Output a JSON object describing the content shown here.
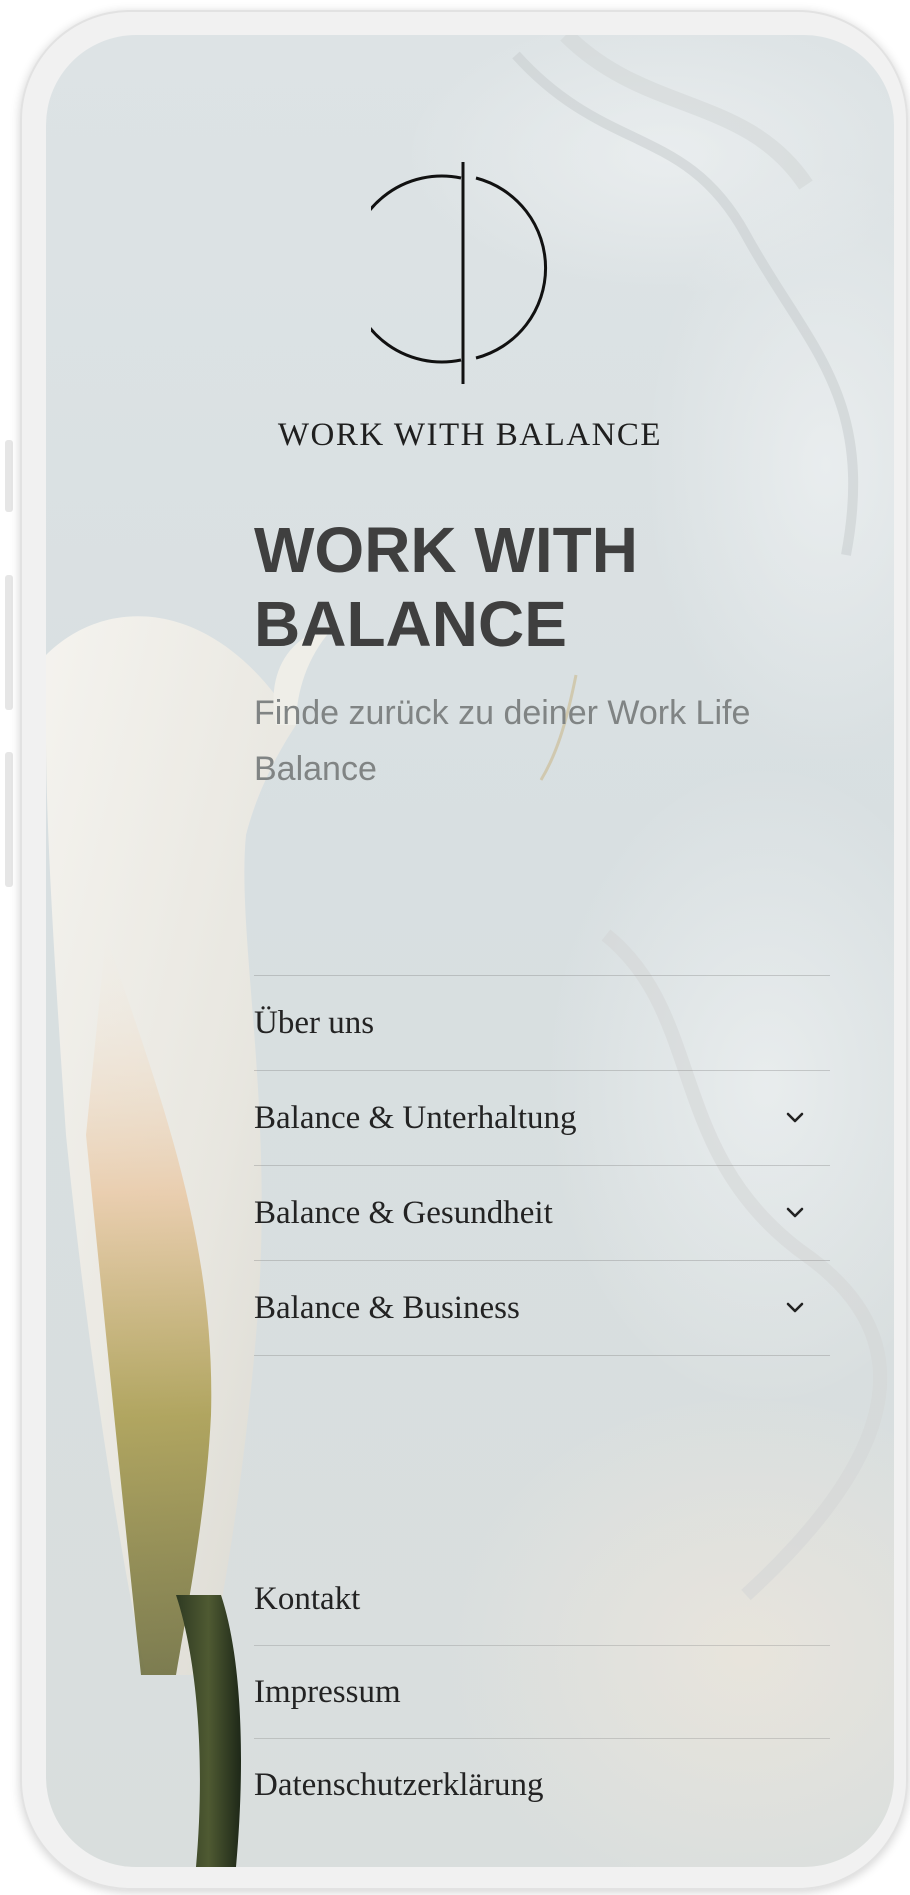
{
  "brand": {
    "logo_icon": "circle-split-logo-icon",
    "wordmark": "WORK WITH BALANCE"
  },
  "hero": {
    "title": "WORK WITH BALANCE",
    "subtitle": "Finde zurück zu deiner Work Life Balance"
  },
  "nav": {
    "items": [
      {
        "label": "Über uns",
        "has_submenu": false
      },
      {
        "label": "Balance & Unterhaltung",
        "has_submenu": true,
        "icon": "chevron-down-icon"
      },
      {
        "label": "Balance & Gesundheit",
        "has_submenu": true,
        "icon": "chevron-down-icon"
      },
      {
        "label": "Balance & Business",
        "has_submenu": true,
        "icon": "chevron-down-icon"
      }
    ]
  },
  "footer": {
    "items": [
      {
        "label": "Kontakt"
      },
      {
        "label": "Impressum"
      },
      {
        "label": "Datenschutzerklärung"
      }
    ]
  },
  "colors": {
    "background": "#dde3e5",
    "heading": "#3f3f3f",
    "subtitle": "#808484",
    "nav_text": "#232323"
  }
}
